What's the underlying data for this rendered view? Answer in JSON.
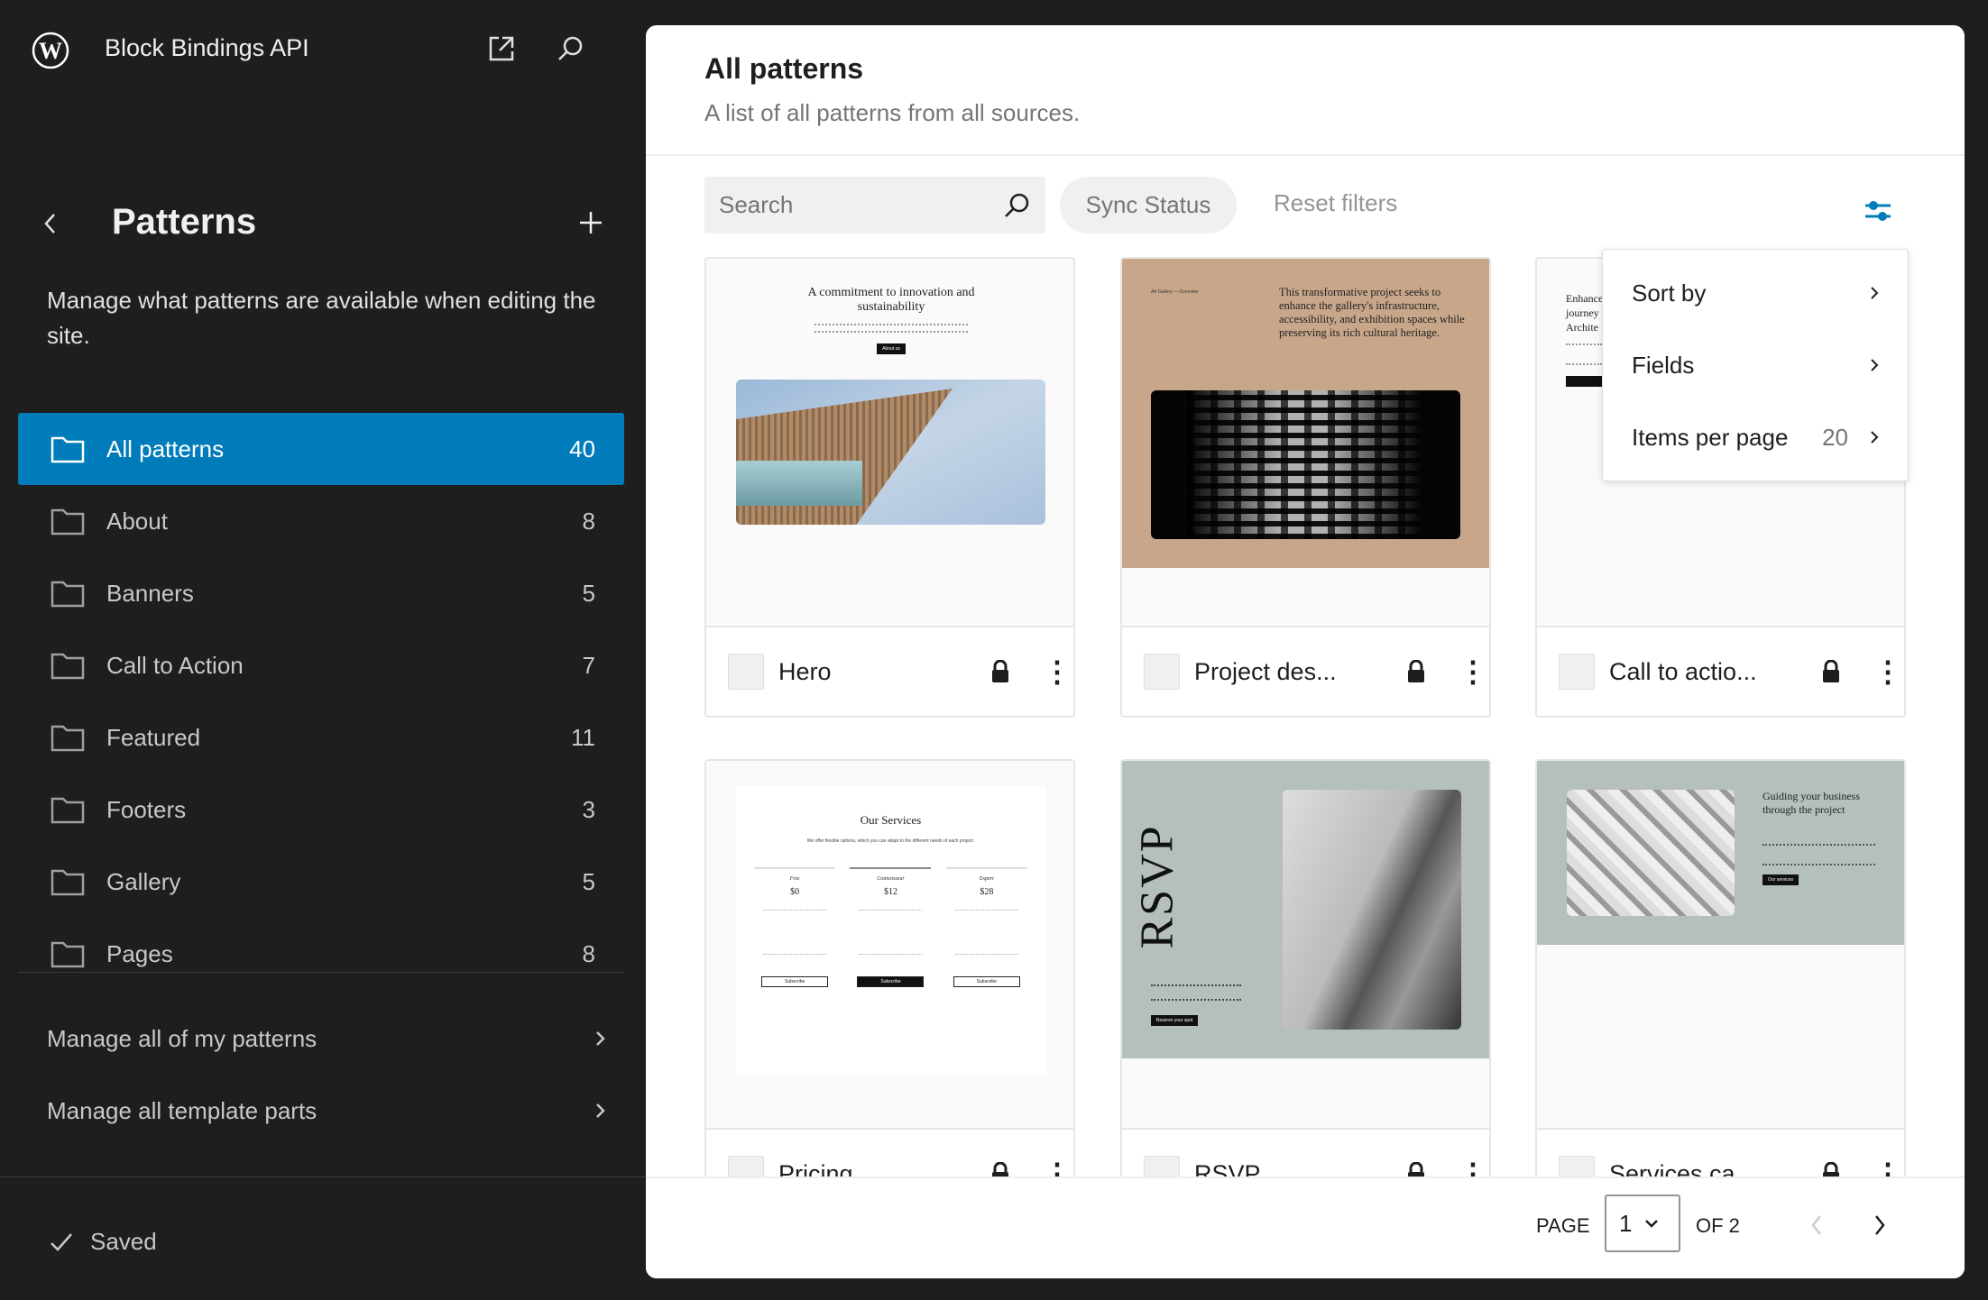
{
  "site": {
    "title": "Block Bindings API"
  },
  "sidebar": {
    "title": "Patterns",
    "description": "Manage what patterns are available when editing the site.",
    "items": [
      {
        "label": "All patterns",
        "count": "40"
      },
      {
        "label": "About",
        "count": "8"
      },
      {
        "label": "Banners",
        "count": "5"
      },
      {
        "label": "Call to Action",
        "count": "7"
      },
      {
        "label": "Featured",
        "count": "11"
      },
      {
        "label": "Footers",
        "count": "3"
      },
      {
        "label": "Gallery",
        "count": "5"
      },
      {
        "label": "Pages",
        "count": "8"
      }
    ],
    "links": [
      "Manage all of my patterns",
      "Manage all template parts"
    ],
    "status": "Saved"
  },
  "main": {
    "title": "All patterns",
    "subtitle": "A list of all patterns from all sources.",
    "search_placeholder": "Search",
    "sync_status": "Sync Status",
    "reset_filters": "Reset filters",
    "accent": "#007cba",
    "view_menu": [
      {
        "label": "Sort by",
        "value": ""
      },
      {
        "label": "Fields",
        "value": ""
      },
      {
        "label": "Items per page",
        "value": "20"
      }
    ],
    "cards": [
      {
        "title": "Hero",
        "heading": "A commitment to innovation and sustainability",
        "button": "About us"
      },
      {
        "title": "Project des...",
        "heading": "This transformative project seeks to enhance the gallery's infrastructure, accessibility, and exhibition spaces while preserving its rich cultural heritage.",
        "kicker": "Art Gallery — Overview"
      },
      {
        "title": "Call to actio...",
        "heading": "Enhance journey Archite"
      },
      {
        "title": "Pricing",
        "heading": "Our Services",
        "sub": "We offer flexible options, which you can adapt to the different needs of each project.",
        "tiers": [
          {
            "name": "Free",
            "price": "$0"
          },
          {
            "name": "Connoisseur",
            "price": "$12"
          },
          {
            "name": "Expert",
            "price": "$28"
          }
        ],
        "button": "Subscribe"
      },
      {
        "title": "RSVP",
        "heading": "RSVP",
        "button": "Reserve your spot"
      },
      {
        "title": "Services ca...",
        "heading": "Guiding your business through the project",
        "button": "Our services"
      }
    ],
    "pagination": {
      "page_label": "PAGE",
      "current": "1",
      "of_label": "OF 2"
    }
  }
}
